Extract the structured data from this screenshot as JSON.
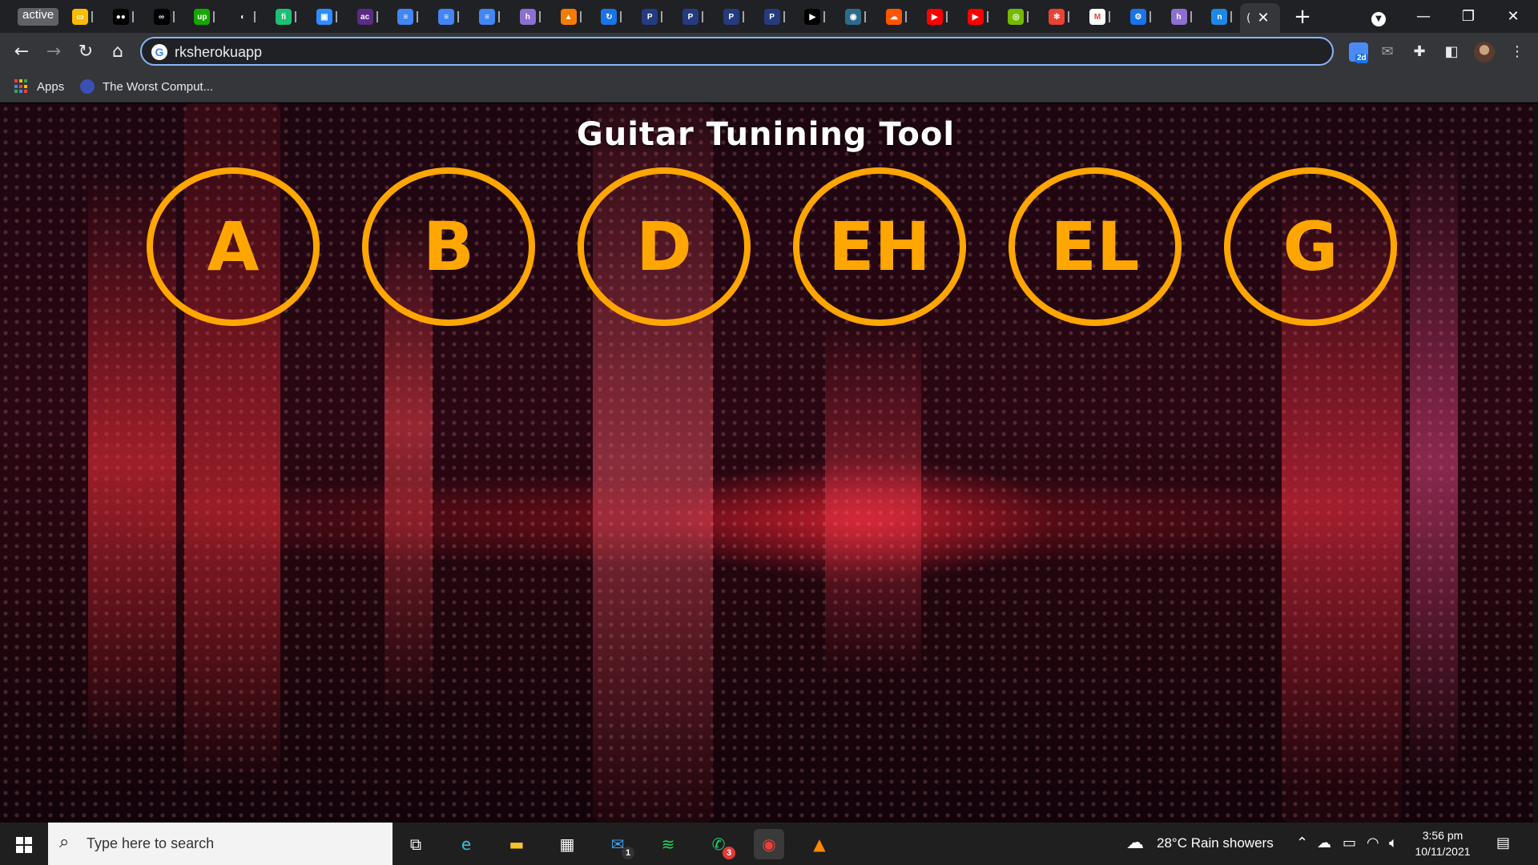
{
  "browser": {
    "tabs": [
      {
        "kind": "text",
        "label": "active"
      },
      {
        "kind": "fav",
        "icon": "yellow-card-icon",
        "color": "#fbbc04",
        "glyph": "▭"
      },
      {
        "kind": "fav",
        "icon": "medium-icon",
        "color": "#000000",
        "glyph": "●●"
      },
      {
        "kind": "fav",
        "icon": "coursera-icon",
        "color": "#000000",
        "glyph": "∞"
      },
      {
        "kind": "fav",
        "icon": "upwork-icon",
        "color": "#14a800",
        "glyph": "up"
      },
      {
        "kind": "fav",
        "icon": "globe-icon",
        "color": "#202124",
        "glyph": "◐"
      },
      {
        "kind": "fav",
        "icon": "fiverr-icon",
        "color": "#1dbf73",
        "glyph": "fi"
      },
      {
        "kind": "fav",
        "icon": "zoom-icon",
        "color": "#2d8cff",
        "glyph": "▣"
      },
      {
        "kind": "fav",
        "icon": "ac-icon",
        "color": "#5b2a86",
        "glyph": "ac"
      },
      {
        "kind": "fav",
        "icon": "docs-icon",
        "color": "#4285f4",
        "glyph": "≡"
      },
      {
        "kind": "fav",
        "icon": "docs-icon",
        "color": "#4285f4",
        "glyph": "≡"
      },
      {
        "kind": "fav",
        "icon": "docs-icon",
        "color": "#4285f4",
        "glyph": "≡"
      },
      {
        "kind": "fav",
        "icon": "hashnode-icon",
        "color": "#8c6fd0",
        "glyph": "h"
      },
      {
        "kind": "fav",
        "icon": "orange-blocks-icon",
        "color": "#f57c00",
        "glyph": "▲"
      },
      {
        "kind": "fav",
        "icon": "blue-loop-icon",
        "color": "#1a73e8",
        "glyph": "↻"
      },
      {
        "kind": "fav",
        "icon": "paypal-icon",
        "color": "#253b80",
        "glyph": "P"
      },
      {
        "kind": "fav",
        "icon": "paypal-icon",
        "color": "#253b80",
        "glyph": "P"
      },
      {
        "kind": "fav",
        "icon": "paypal-icon",
        "color": "#253b80",
        "glyph": "P"
      },
      {
        "kind": "fav",
        "icon": "paypal-icon",
        "color": "#253b80",
        "glyph": "P"
      },
      {
        "kind": "fav",
        "icon": "play-arrow-icon",
        "color": "#000000",
        "glyph": "▶"
      },
      {
        "kind": "fav",
        "icon": "earth-icon",
        "color": "#2e6b8a",
        "glyph": "◉"
      },
      {
        "kind": "fav",
        "icon": "soundcloud-icon",
        "color": "#ff5500",
        "glyph": "☁"
      },
      {
        "kind": "fav",
        "icon": "youtube-icon",
        "color": "#ff0000",
        "glyph": "▶"
      },
      {
        "kind": "fav",
        "icon": "youtube-icon",
        "color": "#ff0000",
        "glyph": "▶"
      },
      {
        "kind": "fav",
        "icon": "nvidia-icon",
        "color": "#76b900",
        "glyph": "◎"
      },
      {
        "kind": "fav",
        "icon": "pinwheel-icon",
        "color": "#ea4335",
        "glyph": "✻"
      },
      {
        "kind": "fav",
        "icon": "gmail-icon",
        "color": "#ffffff",
        "glyph": "M"
      },
      {
        "kind": "fav",
        "icon": "settings-gear-icon",
        "color": "#1a73e8",
        "glyph": "⚙"
      },
      {
        "kind": "fav",
        "icon": "hashnode-icon",
        "color": "#8c6fd0",
        "glyph": "h"
      },
      {
        "kind": "fav",
        "icon": "n-icon",
        "color": "#1e88e5",
        "glyph": "n"
      }
    ],
    "address": "rksherokuapp",
    "bookmarks": [
      {
        "label": "Apps",
        "icon": "apps-grid-icon"
      },
      {
        "label": "The Worst Comput...",
        "icon": "bookmark-favicon-icon"
      }
    ]
  },
  "page": {
    "title": "Guitar Tunining Tool",
    "accent": "#ffa600",
    "notes": [
      "A",
      "B",
      "D",
      "EH",
      "EL",
      "G"
    ]
  },
  "taskbar": {
    "search_placeholder": "Type here to search",
    "apps": [
      {
        "icon": "task-view-icon",
        "glyph": "⧉",
        "color": "#ffffff"
      },
      {
        "icon": "edge-icon",
        "glyph": "e",
        "color": "#2bc6e8"
      },
      {
        "icon": "file-explorer-icon",
        "glyph": "▬",
        "color": "#f4c430"
      },
      {
        "icon": "store-icon",
        "glyph": "▦",
        "color": "#ffffff"
      },
      {
        "icon": "mail-icon",
        "glyph": "✉",
        "color": "#3aa0f0",
        "badge": "1"
      },
      {
        "icon": "spotify-icon",
        "glyph": "≋",
        "color": "#1ed760"
      },
      {
        "icon": "whatsapp-icon",
        "glyph": "✆",
        "color": "#25d366",
        "badge": "3"
      },
      {
        "icon": "chrome-icon",
        "glyph": "◉",
        "color": "#ea4335"
      },
      {
        "icon": "vlc-icon",
        "glyph": "▲",
        "color": "#ff8800"
      }
    ],
    "weather": "28°C  Rain showers",
    "time": "3:56 pm",
    "date": "10/11/2021"
  }
}
